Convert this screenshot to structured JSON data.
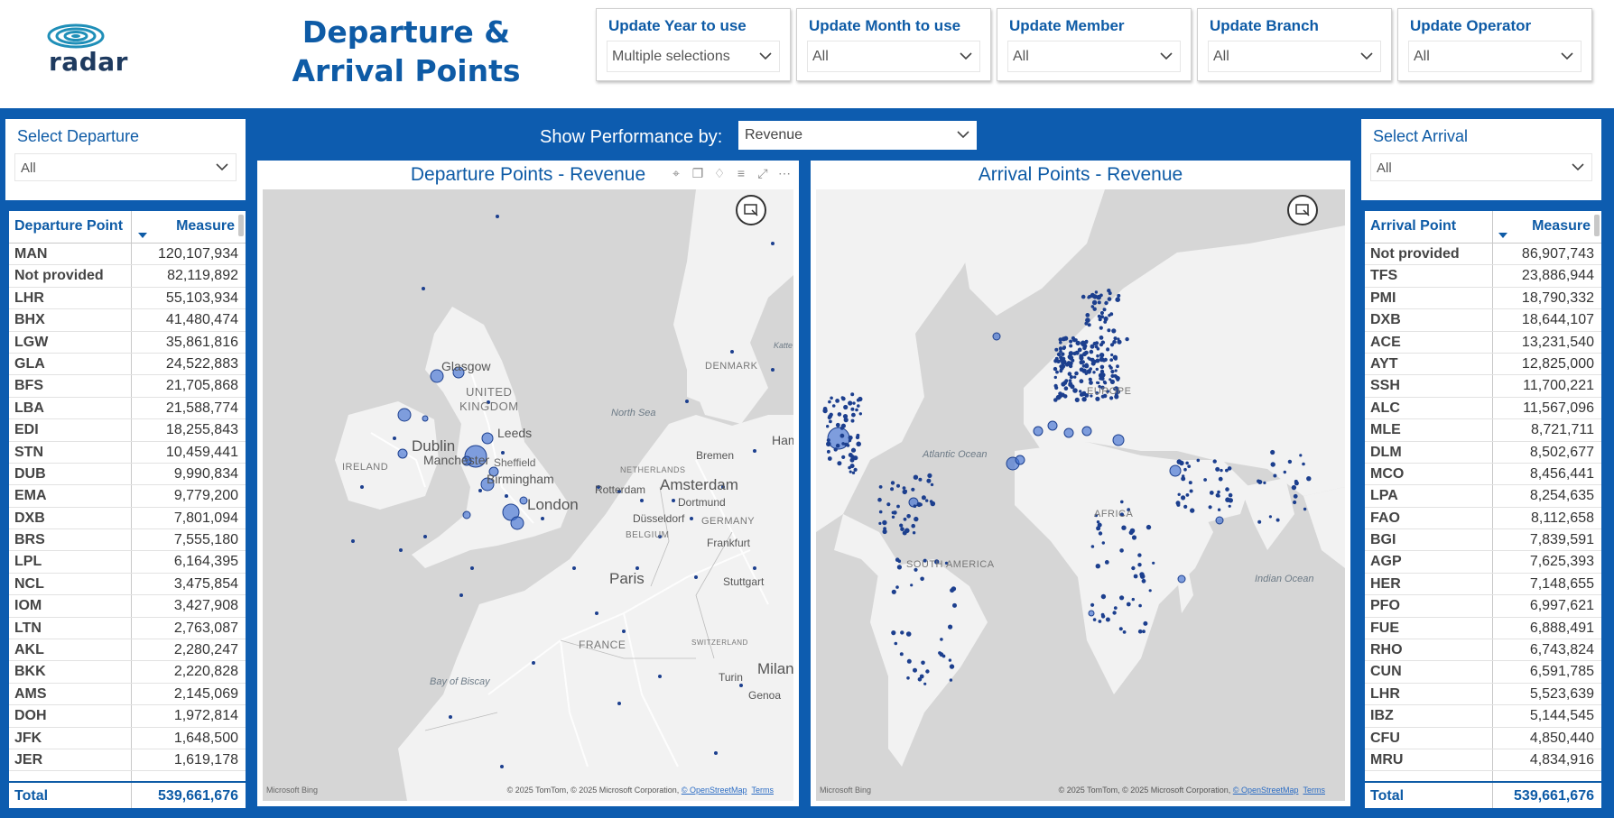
{
  "header": {
    "logo_text": "radar",
    "title_line1": "Departure &",
    "title_line2": "Arrival Points",
    "slicers": [
      {
        "label": "Update Year to use",
        "value": "Multiple selections"
      },
      {
        "label": "Update Month to use",
        "value": "All"
      },
      {
        "label": "Update Member",
        "value": "All"
      },
      {
        "label": "Update Branch",
        "value": "All"
      },
      {
        "label": "Update Operator",
        "value": "All"
      }
    ]
  },
  "departure_select": {
    "title": "Select Departure",
    "value": "All"
  },
  "arrival_select": {
    "title": "Select Arrival",
    "value": "All"
  },
  "performance": {
    "label": "Show Performance by:",
    "value": "Revenue"
  },
  "departure_map": {
    "title": "Departure Points - Revenue"
  },
  "arrival_map": {
    "title": "Arrival Points - Revenue"
  },
  "map_attribution": {
    "bing": "Microsoft Bing",
    "copyright": "© 2025 TomTom, © 2025 Microsoft Corporation,",
    "osm": "© OpenStreetMap",
    "terms": "Terms"
  },
  "departure_map_labels": {
    "glasgow": "Glasgow",
    "united": "UNITED",
    "kingdom": "KINGDOM",
    "leeds": "Leeds",
    "dublin": "Dublin",
    "manchester": "Manchester",
    "sheffield": "Sheffield",
    "birmingham": "Birmingham",
    "ireland": "IRELAND",
    "london": "London",
    "north_sea": "North Sea",
    "denmark": "DENMARK",
    "netherlands": "NETHERLANDS",
    "amsterdam": "Amsterdam",
    "rotterdam": "Rotterdam",
    "bremen": "Bremen",
    "dortmund": "Dortmund",
    "germany": "GERMANY",
    "dusseldorf": "Düsseldorf",
    "belgium": "BELGIUM",
    "frankfurt": "Frankfurt",
    "paris": "Paris",
    "stuttgart": "Stuttgart",
    "france": "FRANCE",
    "switzerland": "SWITZERLAND",
    "bay_of_biscay": "Bay of Biscay",
    "milan": "Milan",
    "turin": "Turin",
    "genoa": "Genoa",
    "ham": "Ham",
    "katte": "Katte"
  },
  "arrival_map_labels": {
    "atlantic": "Atlantic Ocean",
    "europe": "EUROPE",
    "africa": "AFRICA",
    "south_america": "SOUTH AMERICA",
    "indian": "Indian Ocean"
  },
  "departure_table": {
    "col1": "Departure Point",
    "col2": "Measure",
    "rows": [
      [
        "MAN",
        "120,107,934"
      ],
      [
        "Not provided",
        "82,119,892"
      ],
      [
        "LHR",
        "55,103,934"
      ],
      [
        "BHX",
        "41,480,474"
      ],
      [
        "LGW",
        "35,861,816"
      ],
      [
        "GLA",
        "24,522,883"
      ],
      [
        "BFS",
        "21,705,868"
      ],
      [
        "LBA",
        "21,588,774"
      ],
      [
        "EDI",
        "18,255,843"
      ],
      [
        "STN",
        "10,459,441"
      ],
      [
        "DUB",
        "9,990,834"
      ],
      [
        "EMA",
        "9,779,200"
      ],
      [
        "DXB",
        "7,801,094"
      ],
      [
        "BRS",
        "7,555,180"
      ],
      [
        "LPL",
        "6,164,395"
      ],
      [
        "NCL",
        "3,475,854"
      ],
      [
        "IOM",
        "3,427,908"
      ],
      [
        "LTN",
        "2,763,087"
      ],
      [
        "AKL",
        "2,280,247"
      ],
      [
        "BKK",
        "2,220,828"
      ],
      [
        "AMS",
        "2,145,069"
      ],
      [
        "DOH",
        "1,972,814"
      ],
      [
        "JFK",
        "1,648,500"
      ],
      [
        "JER",
        "1,619,178"
      ]
    ],
    "total_label": "Total",
    "total_value": "539,661,676"
  },
  "arrival_table": {
    "col1": "Arrival Point",
    "col2": "Measure",
    "rows": [
      [
        "Not provided",
        "86,907,743"
      ],
      [
        "TFS",
        "23,886,944"
      ],
      [
        "PMI",
        "18,790,332"
      ],
      [
        "DXB",
        "18,644,107"
      ],
      [
        "ACE",
        "13,231,540"
      ],
      [
        "AYT",
        "12,825,000"
      ],
      [
        "SSH",
        "11,700,221"
      ],
      [
        "ALC",
        "11,567,096"
      ],
      [
        "MLE",
        "8,721,711"
      ],
      [
        "DLM",
        "8,502,677"
      ],
      [
        "MCO",
        "8,456,441"
      ],
      [
        "LPA",
        "8,254,635"
      ],
      [
        "FAO",
        "8,112,658"
      ],
      [
        "BGI",
        "7,839,591"
      ],
      [
        "AGP",
        "7,625,393"
      ],
      [
        "HER",
        "7,148,655"
      ],
      [
        "PFO",
        "6,997,621"
      ],
      [
        "FUE",
        "6,888,491"
      ],
      [
        "RHO",
        "6,743,824"
      ],
      [
        "CUN",
        "6,591,785"
      ],
      [
        "LHR",
        "5,523,639"
      ],
      [
        "IBZ",
        "5,144,545"
      ],
      [
        "CFU",
        "4,850,440"
      ],
      [
        "MRU",
        "4,834,916"
      ]
    ],
    "total_label": "Total",
    "total_value": "539,661,676"
  },
  "colors": {
    "brand_blue": "#0d5caf",
    "title_blue": "#0e5ba6",
    "bubble": "#2f63c8",
    "map_land": "#f2f2f2",
    "map_water": "#d6d6d6"
  }
}
